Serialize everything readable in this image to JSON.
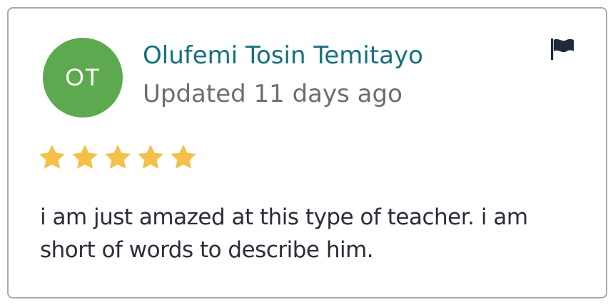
{
  "review": {
    "avatar_initials": "OT",
    "avatar_color": "#5ca94f",
    "author_name": "Olufemi Tosin Temitayo",
    "updated_text": "Updated 11 days ago",
    "rating": 5,
    "rating_max": 5,
    "star_color": "#f5c04a",
    "body": "i am just amazed at this type of teacher. i am short of words to describe him.",
    "flag_icon": "flag-icon"
  }
}
